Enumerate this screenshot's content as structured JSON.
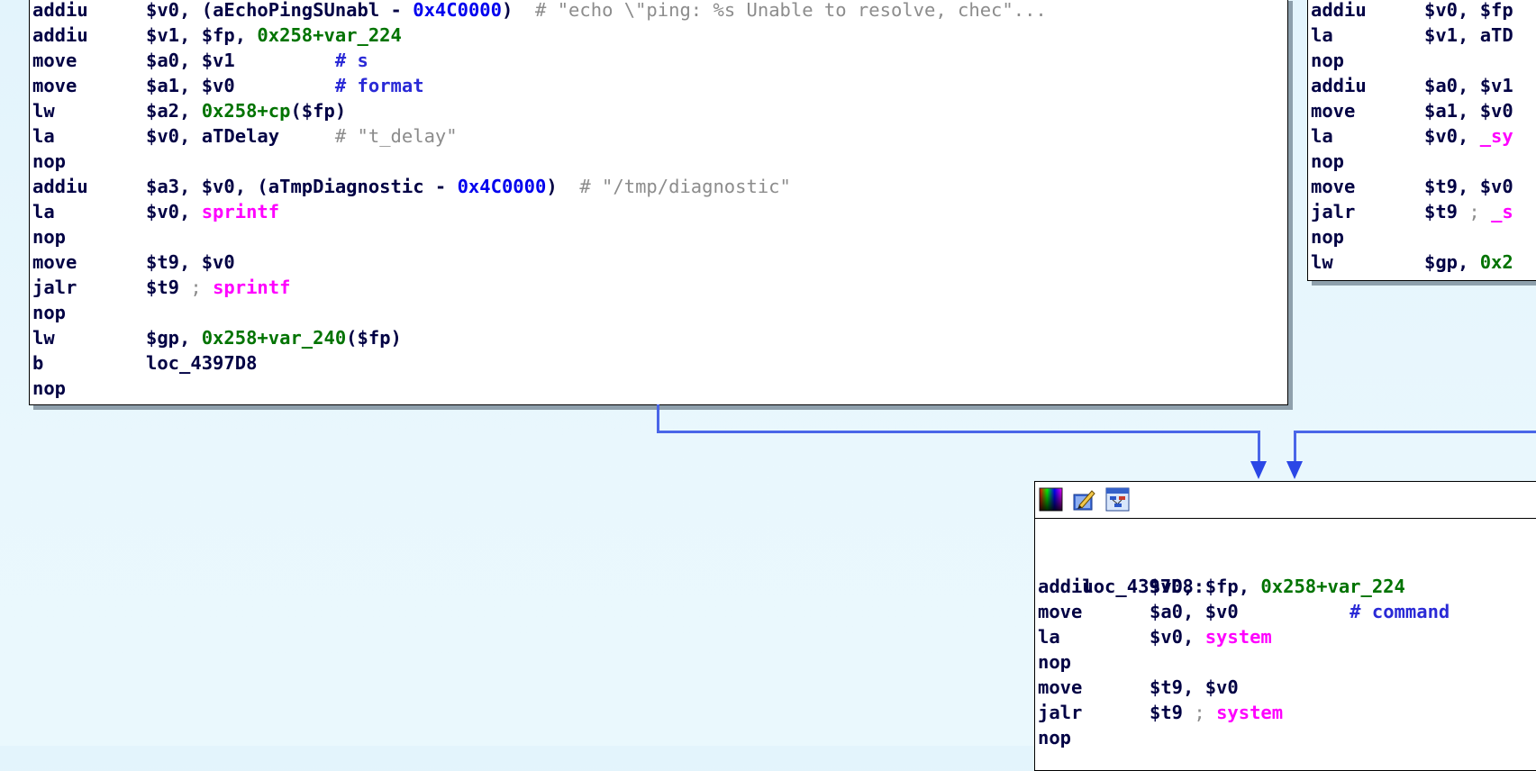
{
  "left_block": {
    "lines": [
      {
        "mnem": "addiu",
        "parts": [
          [
            "reg",
            "$v0, ("
          ],
          [
            "sym",
            "aEchoPingSUnabl"
          ],
          [
            "reg",
            " - "
          ],
          [
            "num",
            "0x4C0000"
          ],
          [
            "reg",
            ")  "
          ],
          [
            "cm",
            "# \"echo \\\"ping: %s Unable to resolve, chec\"..."
          ]
        ]
      },
      {
        "mnem": "addiu",
        "parts": [
          [
            "reg",
            "$v1, $fp, "
          ],
          [
            "var",
            "0x258+var_224"
          ]
        ]
      },
      {
        "mnem": "move",
        "parts": [
          [
            "reg",
            "$a0, $v1         "
          ],
          [
            "cmk",
            "# s"
          ]
        ]
      },
      {
        "mnem": "move",
        "parts": [
          [
            "reg",
            "$a1, $v0         "
          ],
          [
            "cmk",
            "# format"
          ]
        ]
      },
      {
        "mnem": "lw",
        "parts": [
          [
            "reg",
            "$a2, "
          ],
          [
            "var",
            "0x258+cp"
          ],
          [
            "reg",
            "($fp)"
          ]
        ]
      },
      {
        "mnem": "la",
        "parts": [
          [
            "reg",
            "$v0, aTDelay     "
          ],
          [
            "cm",
            "# \"t_delay\""
          ]
        ]
      },
      {
        "mnem": "nop",
        "parts": []
      },
      {
        "mnem": "addiu",
        "parts": [
          [
            "reg",
            "$a3, $v0, (aTmpDiagnostic - "
          ],
          [
            "num",
            "0x4C0000"
          ],
          [
            "reg",
            ")  "
          ],
          [
            "cm",
            "# \"/tmp/diagnostic\""
          ]
        ]
      },
      {
        "mnem": "la",
        "parts": [
          [
            "reg",
            "$v0, "
          ],
          [
            "fn",
            "sprintf"
          ]
        ]
      },
      {
        "mnem": "nop",
        "parts": []
      },
      {
        "mnem": "move",
        "parts": [
          [
            "reg",
            "$t9, $v0"
          ]
        ]
      },
      {
        "mnem": "jalr",
        "parts": [
          [
            "reg",
            "$t9 "
          ],
          [
            "cm",
            "; "
          ],
          [
            "fn",
            "sprintf"
          ]
        ]
      },
      {
        "mnem": "nop",
        "parts": []
      },
      {
        "mnem": "lw",
        "parts": [
          [
            "reg",
            "$gp, "
          ],
          [
            "var",
            "0x258+var_240"
          ],
          [
            "reg",
            "($fp)"
          ]
        ]
      },
      {
        "mnem": "b",
        "parts": [
          [
            "reg",
            "loc_4397D8"
          ]
        ]
      },
      {
        "mnem": "nop",
        "parts": []
      }
    ]
  },
  "right_block": {
    "lines": [
      {
        "mnem": "addiu",
        "parts": [
          [
            "reg",
            "$v0, $fp"
          ]
        ]
      },
      {
        "mnem": "la",
        "parts": [
          [
            "reg",
            "$v1, aTD"
          ]
        ]
      },
      {
        "mnem": "nop",
        "parts": []
      },
      {
        "mnem": "addiu",
        "parts": [
          [
            "reg",
            "$a0, $v1"
          ]
        ]
      },
      {
        "mnem": "move",
        "parts": [
          [
            "reg",
            "$a1, $v0"
          ]
        ]
      },
      {
        "mnem": "la",
        "parts": [
          [
            "reg",
            "$v0, "
          ],
          [
            "fn",
            "_sy"
          ]
        ]
      },
      {
        "mnem": "nop",
        "parts": []
      },
      {
        "mnem": "move",
        "parts": [
          [
            "reg",
            "$t9, $v0"
          ]
        ]
      },
      {
        "mnem": "jalr",
        "parts": [
          [
            "reg",
            "$t9 "
          ],
          [
            "cm",
            "; "
          ],
          [
            "fn",
            "_s"
          ]
        ]
      },
      {
        "mnem": "nop",
        "parts": []
      },
      {
        "mnem": "lw",
        "parts": [
          [
            "reg",
            "$gp, "
          ],
          [
            "var",
            "0x2"
          ]
        ]
      }
    ]
  },
  "bottom_block": {
    "label": "loc_4397D8:",
    "lines": [
      {
        "mnem": "addiu",
        "parts": [
          [
            "reg",
            "$v0, $fp, "
          ],
          [
            "var",
            "0x258+var_224"
          ]
        ]
      },
      {
        "mnem": "move",
        "parts": [
          [
            "reg",
            "$a0, $v0          "
          ],
          [
            "cmk",
            "# command"
          ]
        ]
      },
      {
        "mnem": "la",
        "parts": [
          [
            "reg",
            "$v0, "
          ],
          [
            "fn",
            "system"
          ]
        ]
      },
      {
        "mnem": "nop",
        "parts": []
      },
      {
        "mnem": "move",
        "parts": [
          [
            "reg",
            "$t9, $v0"
          ]
        ]
      },
      {
        "mnem": "jalr",
        "parts": [
          [
            "reg",
            "$t9 "
          ],
          [
            "cm",
            "; "
          ],
          [
            "fn",
            "system"
          ]
        ]
      },
      {
        "mnem": "nop",
        "parts": []
      }
    ],
    "title_icons": [
      "color-palette-icon",
      "edit-node-icon",
      "graph-overview-icon"
    ]
  },
  "colors": {
    "mnemonic": "#000044",
    "number": "#0000ee",
    "variable": "#007300",
    "function": "#ff00ff",
    "comment": "#8c8c8c",
    "edge": "#4a66e8"
  }
}
